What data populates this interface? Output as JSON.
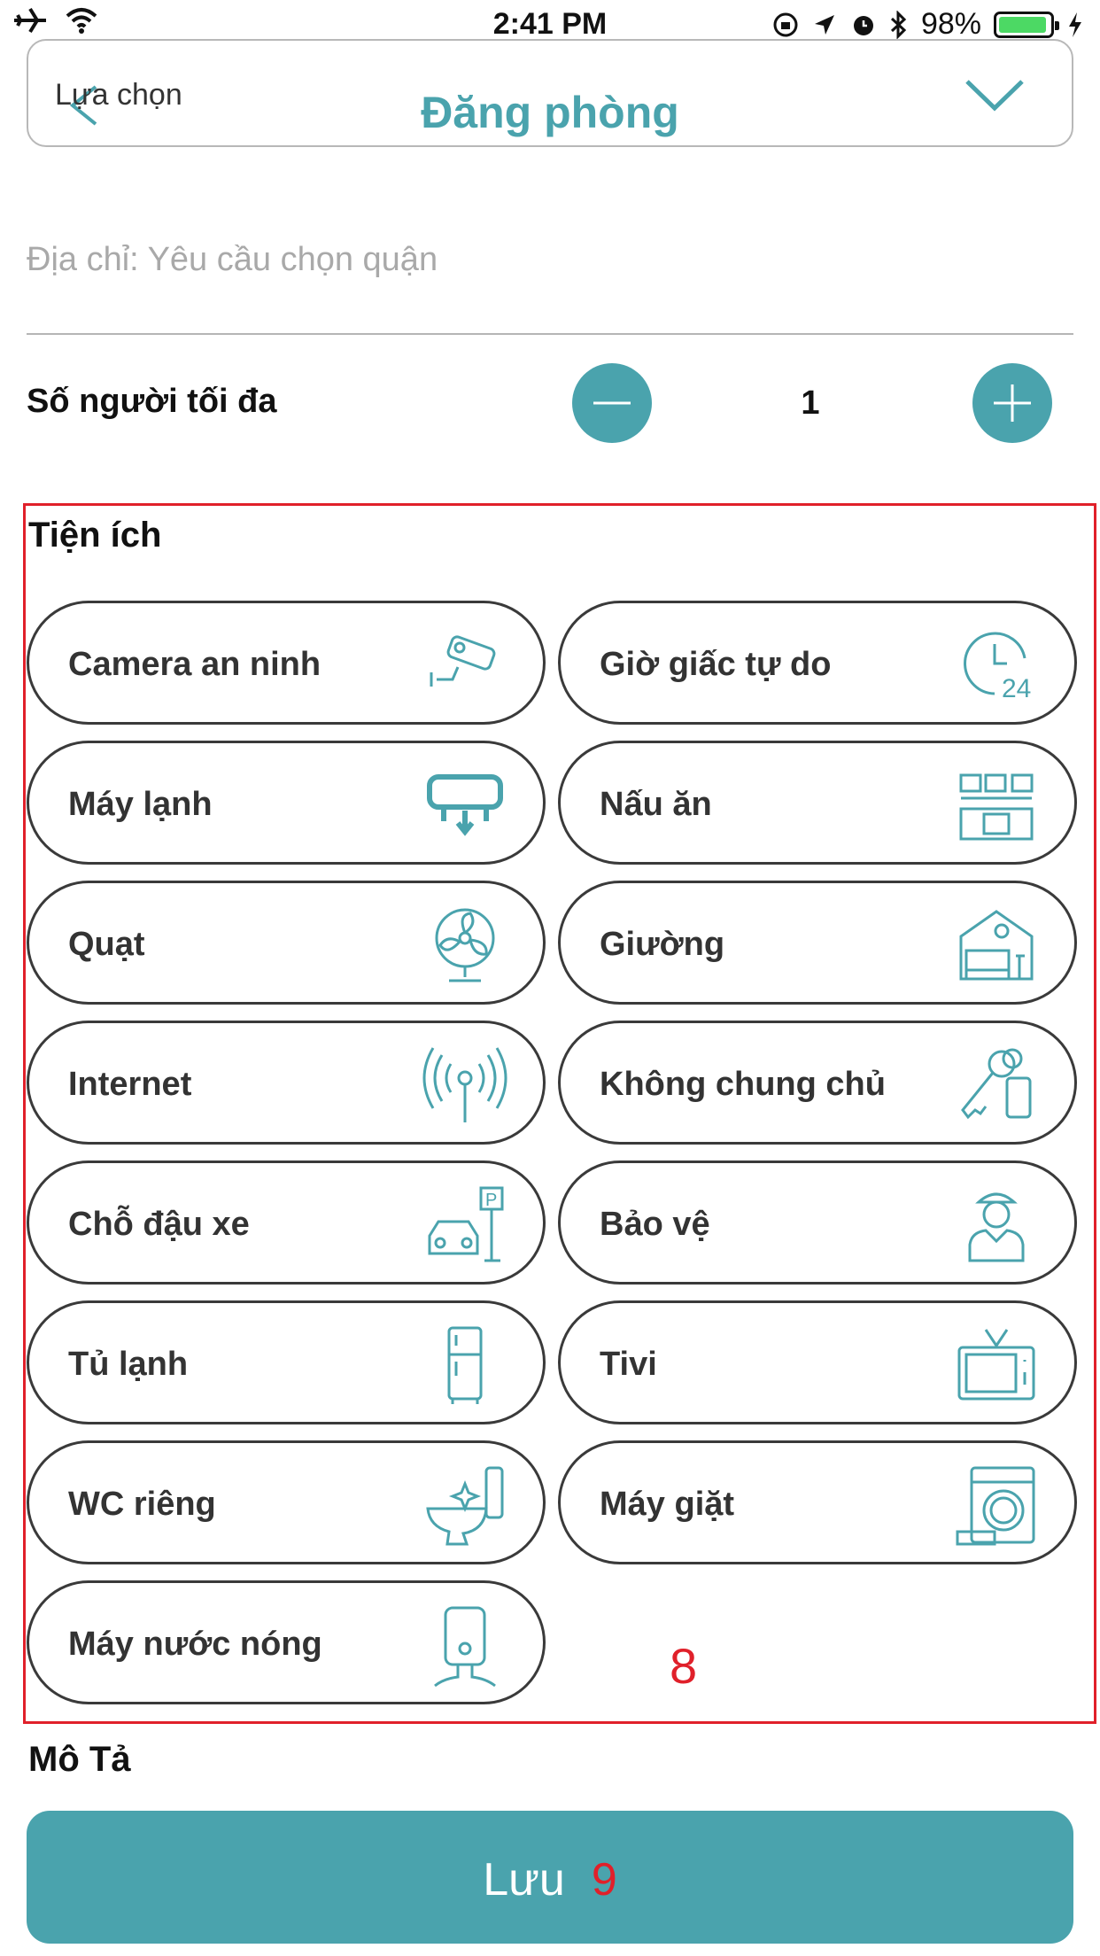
{
  "status_bar": {
    "time": "2:41 PM",
    "battery": "98%"
  },
  "header": {
    "select_label": "Lựa chọn",
    "title": "Đăng phòng"
  },
  "address": {
    "placeholder": "Địa chỉ: Yêu cầu chọn quận"
  },
  "capacity": {
    "label": "Số người tối đa",
    "value": "1"
  },
  "amenities": {
    "title": "Tiện ích",
    "items": [
      {
        "label": "Camera an ninh",
        "icon": "security-camera-icon"
      },
      {
        "label": "Giờ giấc tự do",
        "icon": "clock-24-icon"
      },
      {
        "label": "Máy lạnh",
        "icon": "air-conditioner-icon"
      },
      {
        "label": "Nấu ăn",
        "icon": "kitchen-icon"
      },
      {
        "label": "Quạt",
        "icon": "fan-icon"
      },
      {
        "label": "Giường",
        "icon": "bed-icon"
      },
      {
        "label": "Internet",
        "icon": "antenna-icon"
      },
      {
        "label": "Không chung chủ",
        "icon": "keys-icon"
      },
      {
        "label": "Chỗ đậu xe",
        "icon": "parking-icon"
      },
      {
        "label": "Bảo vệ",
        "icon": "guard-icon"
      },
      {
        "label": "Tủ lạnh",
        "icon": "fridge-icon"
      },
      {
        "label": "Tivi",
        "icon": "tv-icon"
      },
      {
        "label": "WC riêng",
        "icon": "toilet-icon"
      },
      {
        "label": "Máy giặt",
        "icon": "washing-machine-icon"
      },
      {
        "label": "Máy nước nóng",
        "icon": "water-heater-icon"
      }
    ]
  },
  "annotations": {
    "amenities_marker": "8",
    "save_marker": "9"
  },
  "description": {
    "label": "Mô Tả"
  },
  "save_button": {
    "label": "Lưu"
  },
  "colors": {
    "accent": "#4aa3ad",
    "annotation": "#e0202a"
  }
}
